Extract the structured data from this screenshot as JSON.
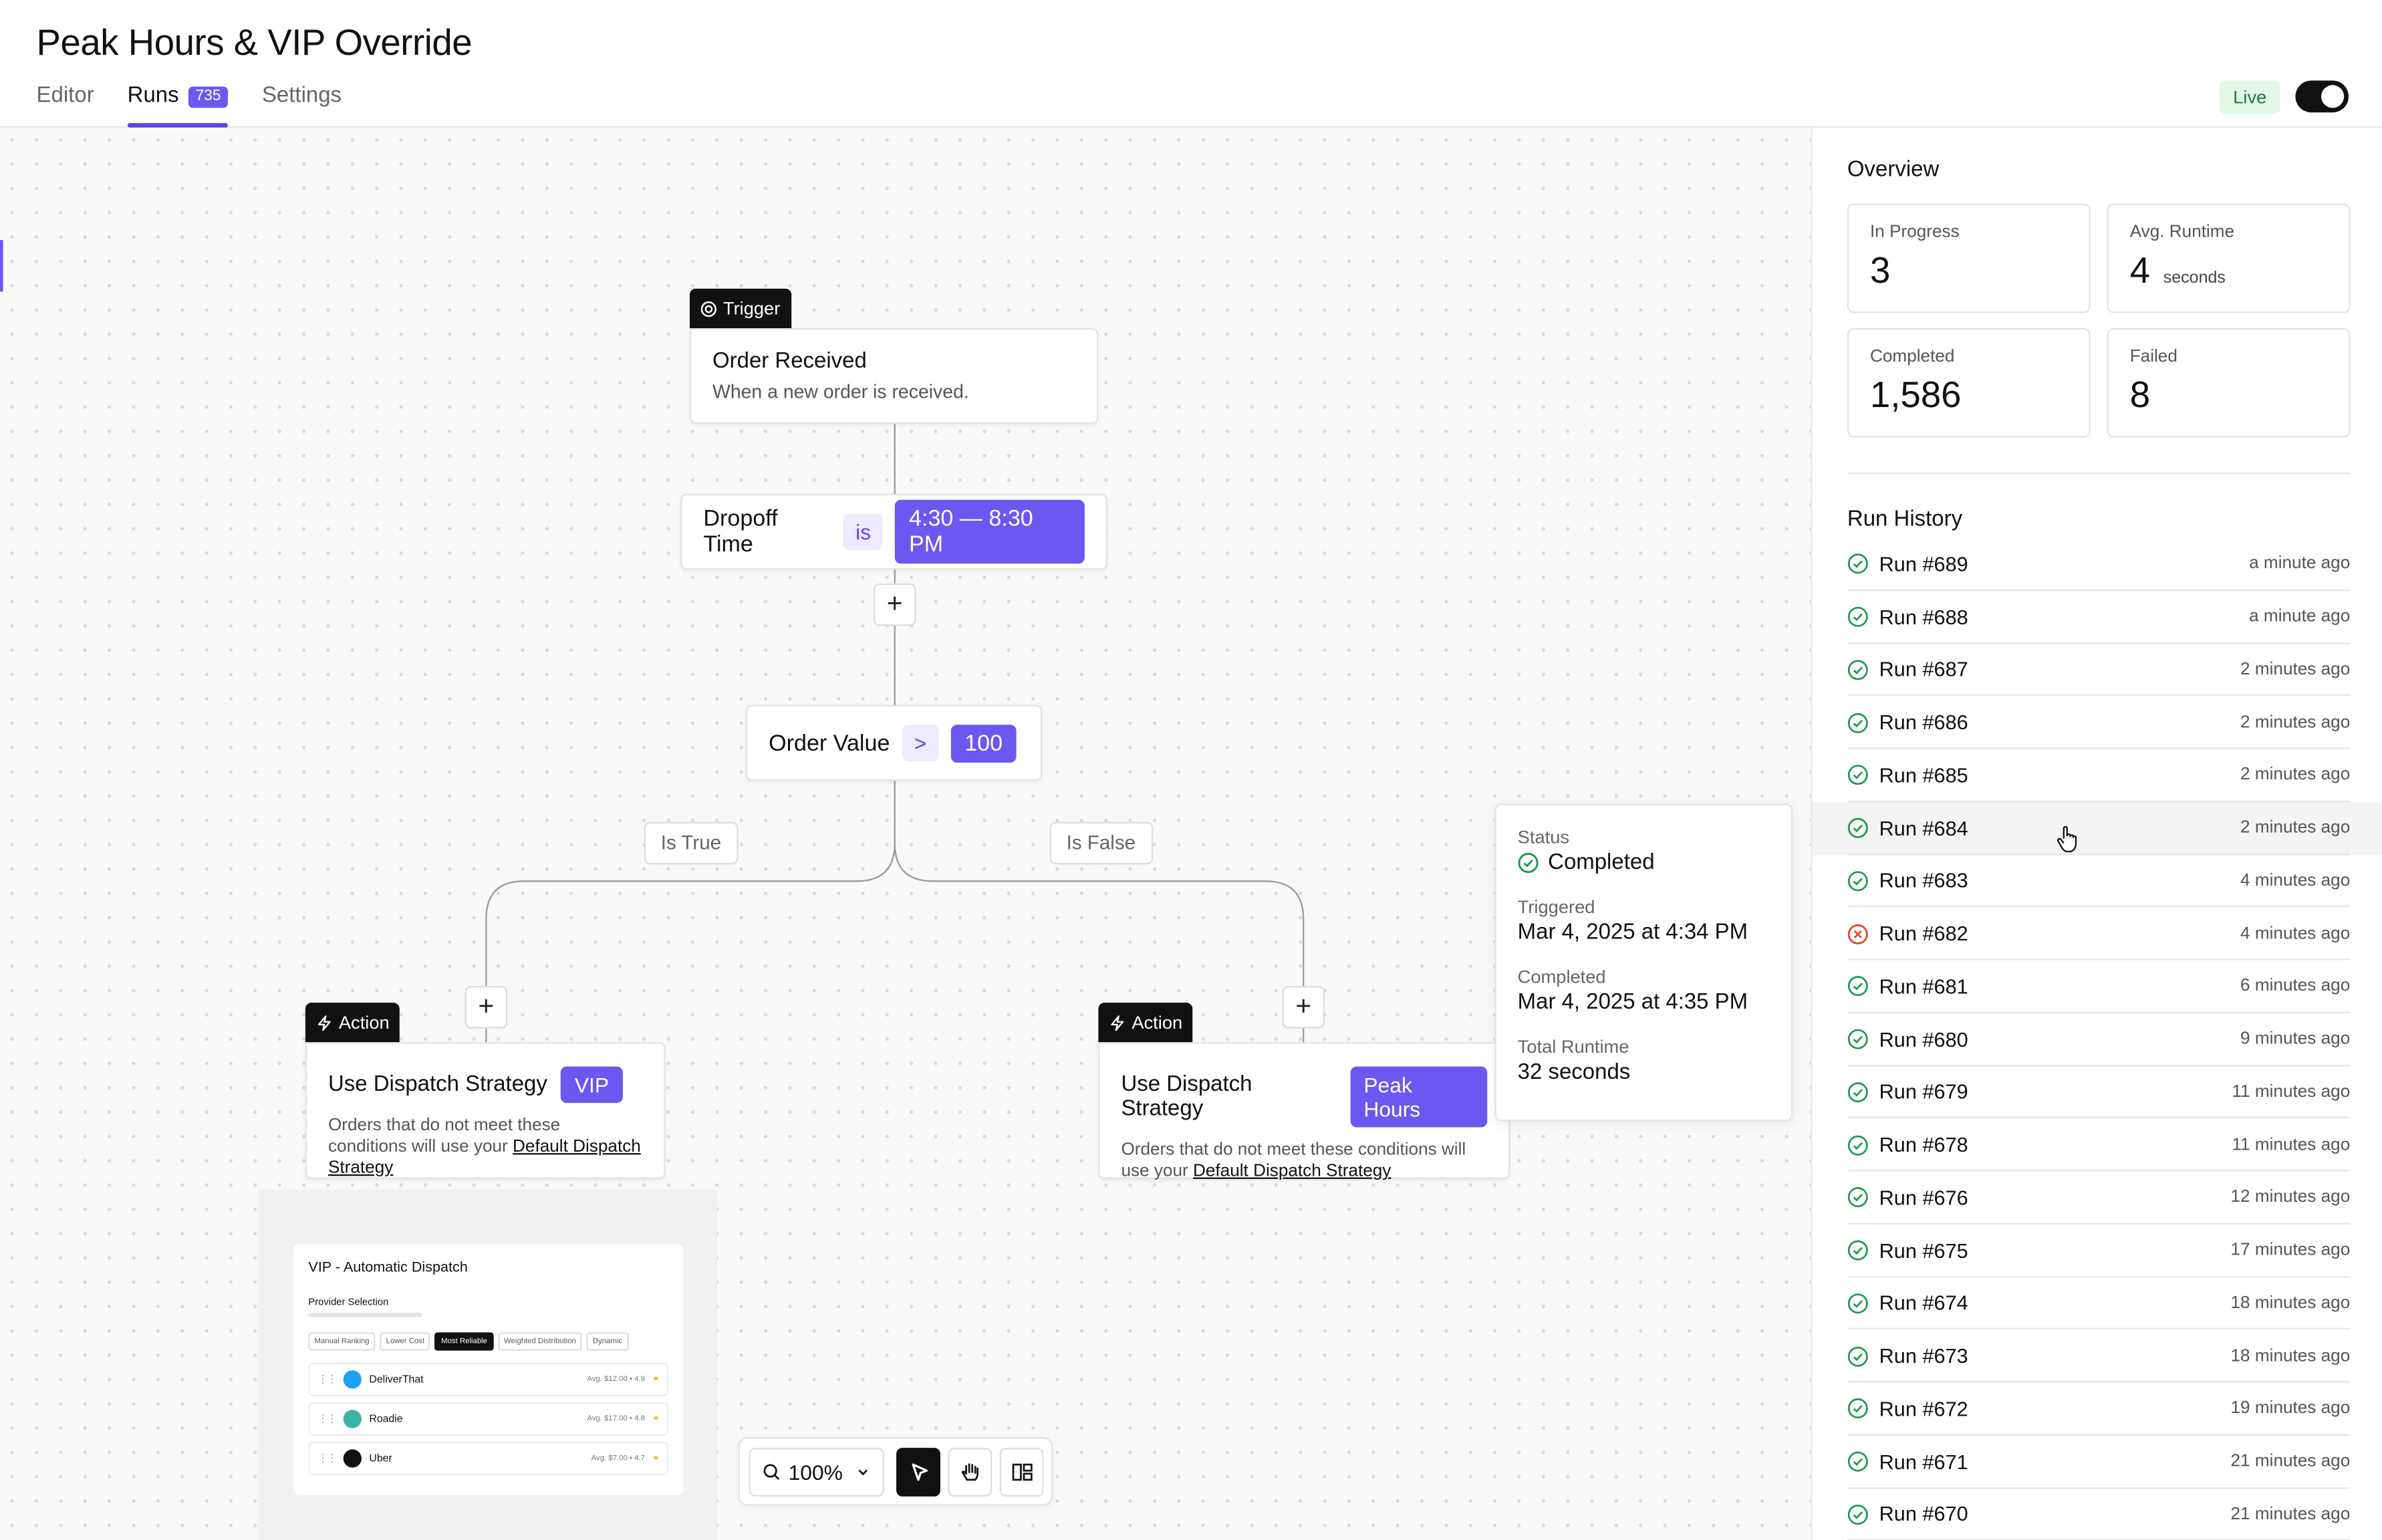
{
  "header": {
    "title": "Peak Hours & VIP Override",
    "tabs": [
      {
        "label": "Editor"
      },
      {
        "label": "Runs",
        "badge": "735",
        "active": true
      },
      {
        "label": "Settings"
      }
    ],
    "status_label": "Live",
    "live_toggle_on": true
  },
  "canvas": {
    "trigger": {
      "tag": "Trigger",
      "title": "Order Received",
      "subtitle": "When a new order is received."
    },
    "condition1": {
      "field": "Dropoff Time",
      "operator": "is",
      "value": "4:30 — 8:30 PM"
    },
    "condition2": {
      "field": "Order Value",
      "operator": ">",
      "value": "100"
    },
    "branch_true": "Is True",
    "branch_false": "Is False",
    "action_left": {
      "tag": "Action",
      "title": "Use Dispatch Strategy",
      "chip": "VIP",
      "desc": "Orders that do not meet these conditions will use your",
      "link": "Default Dispatch Strategy"
    },
    "action_right": {
      "tag": "Action",
      "title": "Use Dispatch Strategy",
      "chip": "Peak Hours",
      "desc": "Orders that do not meet these conditions will use your",
      "link": "Default Dispatch Strategy"
    },
    "plus": "+",
    "preview": {
      "title": "VIP - Automatic Dispatch",
      "section": "Provider Selection",
      "chips": [
        "Manual Ranking",
        "Lower Cost",
        "Most Reliable",
        "Weighted Distribution",
        "Dynamic"
      ],
      "selected_chip": "Most Reliable",
      "providers": [
        {
          "name": "DeliverThat",
          "meta": "Avg. $12.00 • 4.9",
          "color": "#1da1f2"
        },
        {
          "name": "Roadie",
          "meta": "Avg. $17.00 • 4.8",
          "color": "#3bb3a6"
        },
        {
          "name": "Uber",
          "meta": "Avg. $7.00 • 4.7",
          "color": "#111111"
        }
      ]
    },
    "zoom": "100%",
    "accent_color": "#6b58f0"
  },
  "run_detail": {
    "status_label": "Status",
    "status_value": "Completed",
    "triggered_label": "Triggered",
    "triggered_value": "Mar 4, 2025 at 4:34 PM",
    "completed_label": "Completed",
    "completed_value": "Mar 4, 2025 at 4:35 PM",
    "runtime_label": "Total Runtime",
    "runtime_value": "32 seconds"
  },
  "sidebar": {
    "overview_title": "Overview",
    "stats": [
      {
        "label": "In Progress",
        "value": "3",
        "unit": ""
      },
      {
        "label": "Avg. Runtime",
        "value": "4",
        "unit": "seconds"
      },
      {
        "label": "Completed",
        "value": "1,586",
        "unit": ""
      },
      {
        "label": "Failed",
        "value": "8",
        "unit": ""
      }
    ],
    "history_title": "Run History",
    "runs": [
      {
        "name": "Run #689",
        "time": "a minute ago",
        "status": "success"
      },
      {
        "name": "Run #688",
        "time": "a minute ago",
        "status": "success"
      },
      {
        "name": "Run #687",
        "time": "2 minutes ago",
        "status": "success"
      },
      {
        "name": "Run #686",
        "time": "2 minutes ago",
        "status": "success"
      },
      {
        "name": "Run #685",
        "time": "2 minutes ago",
        "status": "success"
      },
      {
        "name": "Run #684",
        "time": "2 minutes ago",
        "status": "success"
      },
      {
        "name": "Run #683",
        "time": "4 minutes ago",
        "status": "success"
      },
      {
        "name": "Run #682",
        "time": "4 minutes ago",
        "status": "failed"
      },
      {
        "name": "Run #681",
        "time": "6 minutes ago",
        "status": "success"
      },
      {
        "name": "Run #680",
        "time": "9 minutes ago",
        "status": "success"
      },
      {
        "name": "Run #679",
        "time": "11 minutes ago",
        "status": "success"
      },
      {
        "name": "Run #678",
        "time": "11 minutes ago",
        "status": "success"
      },
      {
        "name": "Run #676",
        "time": "12 minutes ago",
        "status": "success"
      },
      {
        "name": "Run #675",
        "time": "17 minutes ago",
        "status": "success"
      },
      {
        "name": "Run #674",
        "time": "18 minutes ago",
        "status": "success"
      },
      {
        "name": "Run #673",
        "time": "18 minutes ago",
        "status": "success"
      },
      {
        "name": "Run #672",
        "time": "19 minutes ago",
        "status": "success"
      },
      {
        "name": "Run #671",
        "time": "21 minutes ago",
        "status": "success"
      },
      {
        "name": "Run #670",
        "time": "21 minutes ago",
        "status": "success"
      }
    ],
    "success_color": "#1f9a4c",
    "failed_color": "#e0462d"
  }
}
